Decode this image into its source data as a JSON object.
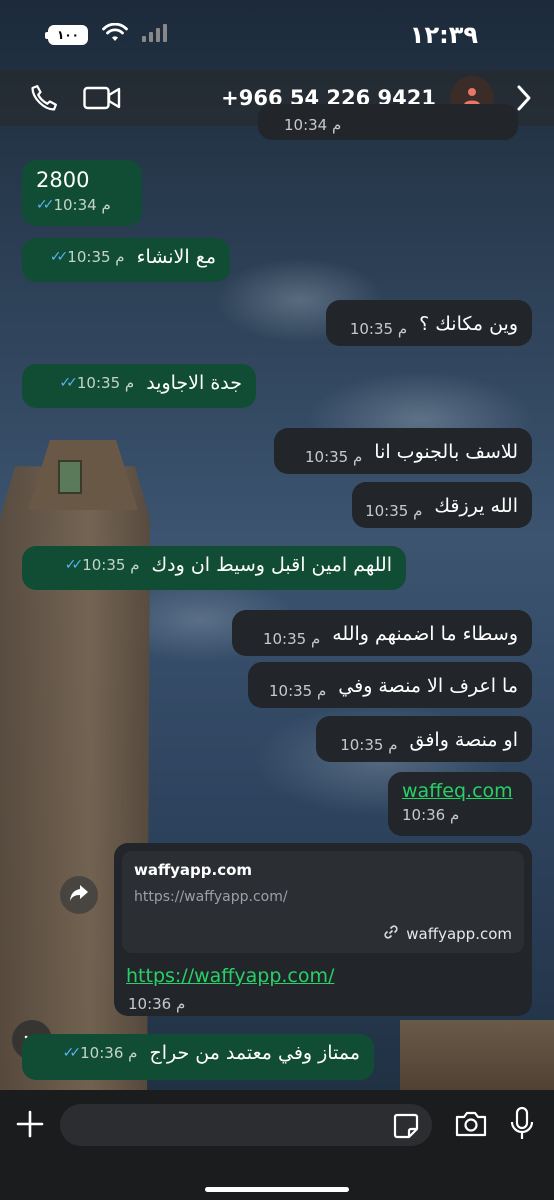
{
  "status_bar": {
    "battery": "١٠٠",
    "time": "١٢:٣٩"
  },
  "header": {
    "phone_number": "+966 54 226 9421"
  },
  "messages": [
    {
      "text": "2800",
      "time": "10:34 م",
      "direction": "out"
    },
    {
      "text": "مع الانشاء",
      "time": "10:35 م",
      "direction": "out"
    },
    {
      "text": "وين مكانك ؟",
      "time": "10:35 م",
      "direction": "in"
    },
    {
      "text": "جدة الاجاويد",
      "time": "10:35 م",
      "direction": "out"
    },
    {
      "text": "للاسف بالجنوب انا",
      "time": "10:35 م",
      "direction": "in"
    },
    {
      "text": "الله يرزقك",
      "time": "10:35 م",
      "direction": "in"
    },
    {
      "text": "اللهم امين اقبل وسيط ان ودك",
      "time": "10:35 م",
      "direction": "out"
    },
    {
      "text": "وسطاء ما اضمنهم والله",
      "time": "10:35 م",
      "direction": "in"
    },
    {
      "text": "ما اعرف الا منصة وفي",
      "time": "10:35 م",
      "direction": "in"
    },
    {
      "text": "او منصة وافق",
      "time": "10:35 م",
      "direction": "in"
    },
    {
      "text": "waffeq.com",
      "time": "10:36 م",
      "direction": "in"
    },
    {
      "text": "ممتاز وفي معتمد من حراج",
      "time": "10:36 م",
      "direction": "out"
    }
  ],
  "top_partial_time": "10:34 م",
  "link_preview": {
    "title": "waffyapp.com",
    "url": "https://waffyapp.com/",
    "domain": "waffyapp.com",
    "link_text": "https://waffyapp.com/",
    "time": "10:36 م"
  },
  "composer": {
    "placeholder": ""
  },
  "colors": {
    "outgoing_bubble": "#114d34",
    "incoming_bubble": "#222529",
    "link_blue": "#3ea8f0",
    "link_green": "#27d167",
    "read_ticks": "#5ab3f0"
  }
}
